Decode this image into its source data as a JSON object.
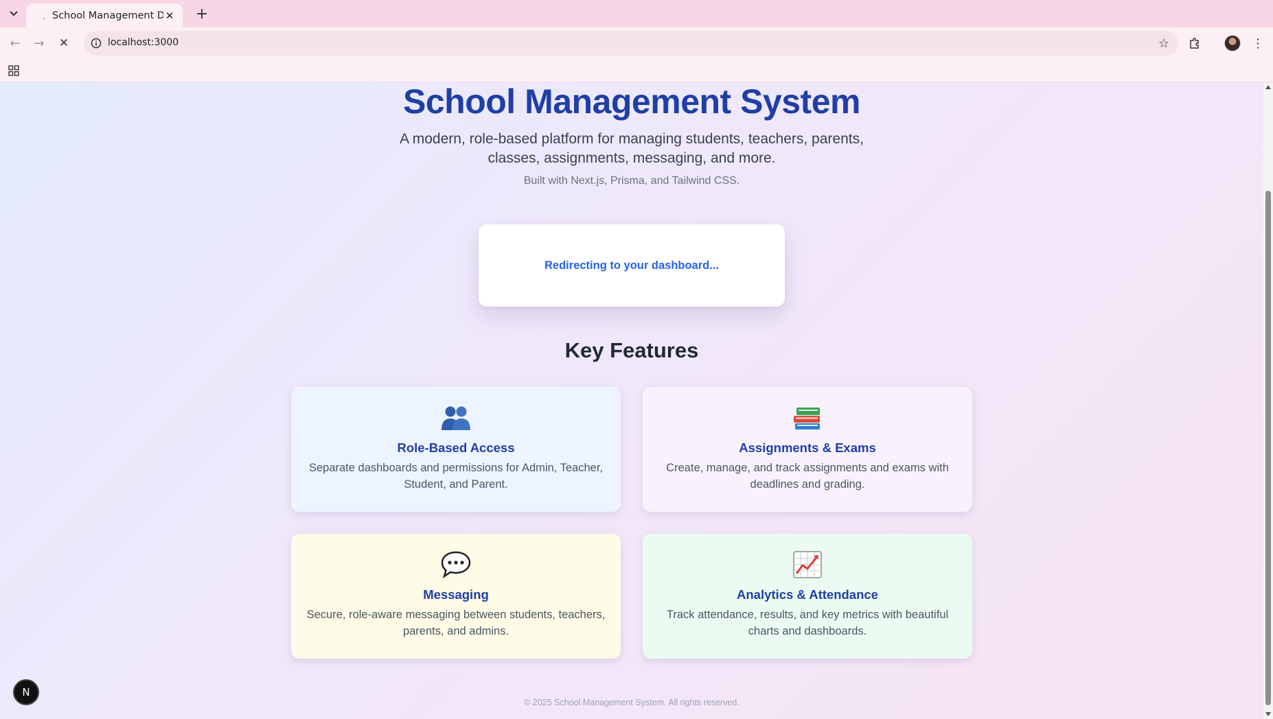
{
  "browser": {
    "tab_title": "School Management Das",
    "tab_loading_glyph": ".",
    "new_tab_glyph": "+",
    "close_glyph": "✕",
    "url": "localhost:3000",
    "back_glyph": "←",
    "forward_glyph": "→",
    "stop_glyph": "✕",
    "star_glyph": "☆",
    "menu_glyph": "⋮"
  },
  "hero": {
    "title": "School Management System",
    "subtitle": "A modern, role-based platform for managing students, teachers, parents, classes, assignments, messaging, and more.",
    "built_with": "Built with Next.js, Prisma, and Tailwind CSS."
  },
  "redirect": {
    "message": "Redirecting to your dashboard..."
  },
  "features": {
    "heading": "Key Features",
    "items": [
      {
        "icon": "people-icon",
        "title": "Role-Based Access",
        "description": "Separate dashboards and permissions for Admin, Teacher, Student, and Parent."
      },
      {
        "icon": "books-icon",
        "title": "Assignments & Exams",
        "description": "Create, manage, and track assignments and exams with deadlines and grading."
      },
      {
        "icon": "speech-bubble-icon",
        "title": "Messaging",
        "description": "Secure, role-aware messaging between students, teachers, parents, and admins."
      },
      {
        "icon": "chart-increasing-icon",
        "title": "Analytics & Attendance",
        "description": "Track attendance, results, and key metrics with beautiful charts and dashboards."
      }
    ]
  },
  "footer": {
    "text": "© 2025 School Management System. All rights reserved."
  },
  "dev_badge": {
    "letter": "N"
  },
  "colors": {
    "brand_blue": "#1f3fa6",
    "link_blue": "#2563eb",
    "card_blue": "#eef4ff",
    "card_purple": "#f8f2fd",
    "card_yellow": "#fefbe6",
    "card_green": "#ecfbf2"
  }
}
